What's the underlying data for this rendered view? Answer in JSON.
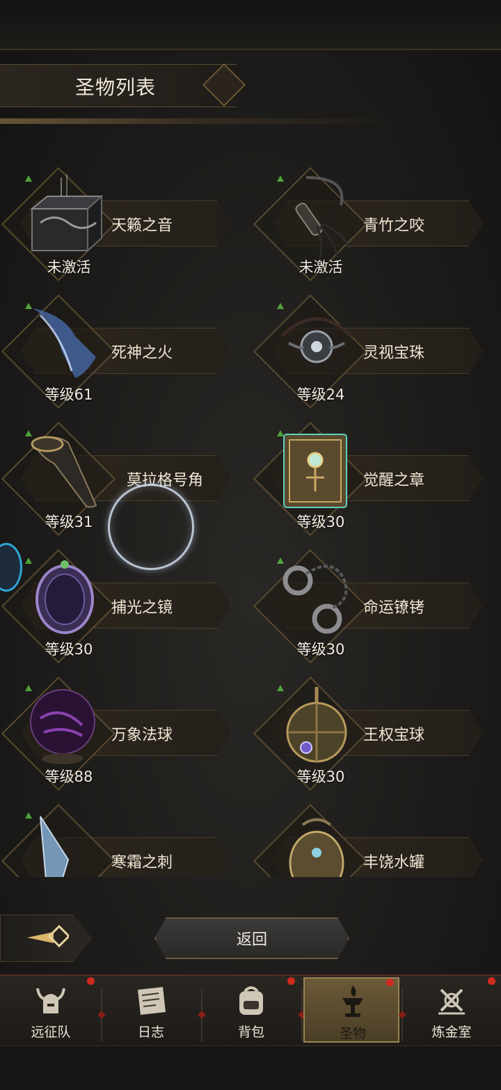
{
  "header": {
    "title": "圣物列表"
  },
  "relics": [
    {
      "name": "天籁之音",
      "status": "未激活",
      "icon": "cage-box-icon"
    },
    {
      "name": "青竹之咬",
      "status": "未激活",
      "icon": "whip-icon"
    },
    {
      "name": "死神之火",
      "status": "等级61",
      "icon": "spectral-hand-icon"
    },
    {
      "name": "灵视宝珠",
      "status": "等级24",
      "icon": "orb-necklace-icon"
    },
    {
      "name": "莫拉格号角",
      "status": "等级31",
      "icon": "horn-icon"
    },
    {
      "name": "觉醒之章",
      "status": "等级30",
      "icon": "tome-icon"
    },
    {
      "name": "捕光之镜",
      "status": "等级30",
      "icon": "mirror-icon"
    },
    {
      "name": "命运镣铐",
      "status": "等级30",
      "icon": "shackles-icon"
    },
    {
      "name": "万象法球",
      "status": "等级88",
      "icon": "dark-orb-icon"
    },
    {
      "name": "王权宝球",
      "status": "等级30",
      "icon": "royal-orb-icon"
    },
    {
      "name": "寒霜之刺",
      "status": "",
      "icon": "ice-shard-icon"
    },
    {
      "name": "丰饶水罐",
      "status": "",
      "icon": "urn-icon"
    }
  ],
  "actions": {
    "back_label": "返回"
  },
  "tabs": [
    {
      "label": "远征队",
      "icon": "horned-helmet-icon",
      "badge": true
    },
    {
      "label": "日志",
      "icon": "scroll-icon",
      "badge": false
    },
    {
      "label": "背包",
      "icon": "backpack-icon",
      "badge": true
    },
    {
      "label": "圣物",
      "icon": "brazier-icon",
      "badge": true,
      "active": true
    },
    {
      "label": "炼金室",
      "icon": "alchemy-icon",
      "badge": true
    }
  ],
  "colors": {
    "accent_gold": "#9a8352",
    "badge_red": "#d12a1e",
    "upgrade_green": "#4fa33b"
  }
}
